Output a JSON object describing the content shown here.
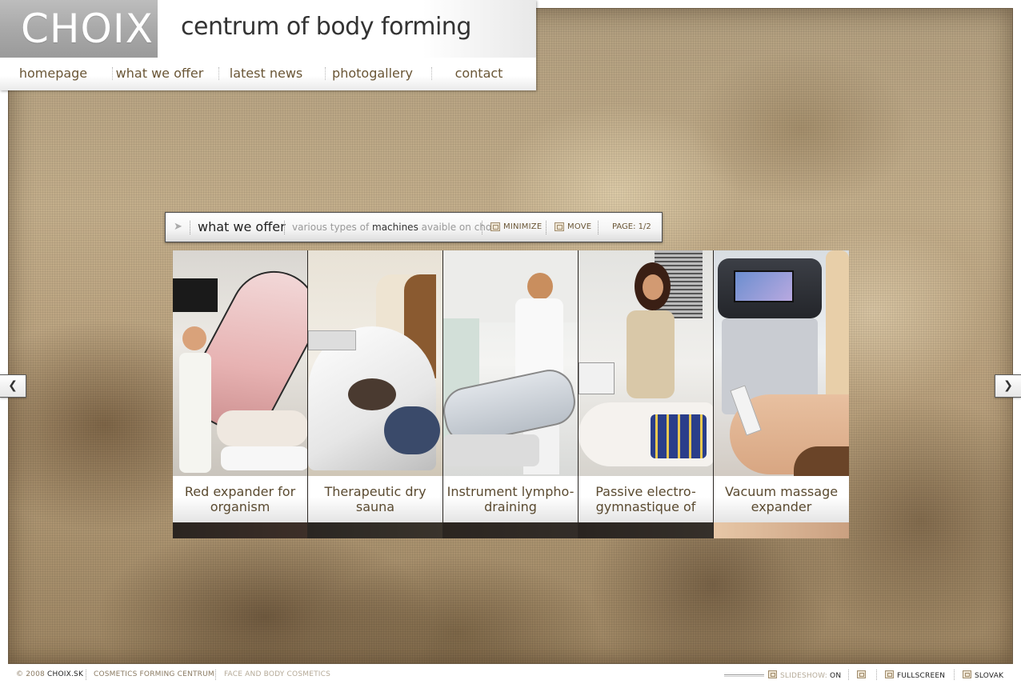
{
  "brand": {
    "logo": "CHOIX",
    "tagline": "centrum of body forming"
  },
  "nav": [
    {
      "label": "homepage"
    },
    {
      "label": "what we offer"
    },
    {
      "label": "latest news"
    },
    {
      "label": "photogallery"
    },
    {
      "label": "contact"
    }
  ],
  "panel": {
    "title": "what we offer",
    "desc_pre": "various types of ",
    "desc_bold": "machines",
    "desc_post": " avaible on choix",
    "minimize_label": "MINIMIZE",
    "move_label": "MOVE",
    "page_label": "PAGE: 1/2"
  },
  "cards": [
    {
      "title": "Red expander for organism"
    },
    {
      "title": "Therapeutic dry sauna"
    },
    {
      "title": "Instrument lympho-draining"
    },
    {
      "title": "Passive electro-gymnastique of"
    },
    {
      "title": "Vacuum massage expander"
    }
  ],
  "footer": {
    "copyright_pre": "© 2008 ",
    "copyright_site": "CHOIX.SK",
    "link1": "COSMETICS FORMING CENTRUM",
    "link2": "FACE AND BODY COSMETICS",
    "slideshow_label": "SLIDESHOW: ",
    "slideshow_state": "ON",
    "fullscreen_label": "FULLSCREEN",
    "language_label": "SLOVAK"
  },
  "icons": {
    "prev": "chevron-left-icon",
    "next": "chevron-right-icon",
    "panel": "chevron-right-icon"
  }
}
